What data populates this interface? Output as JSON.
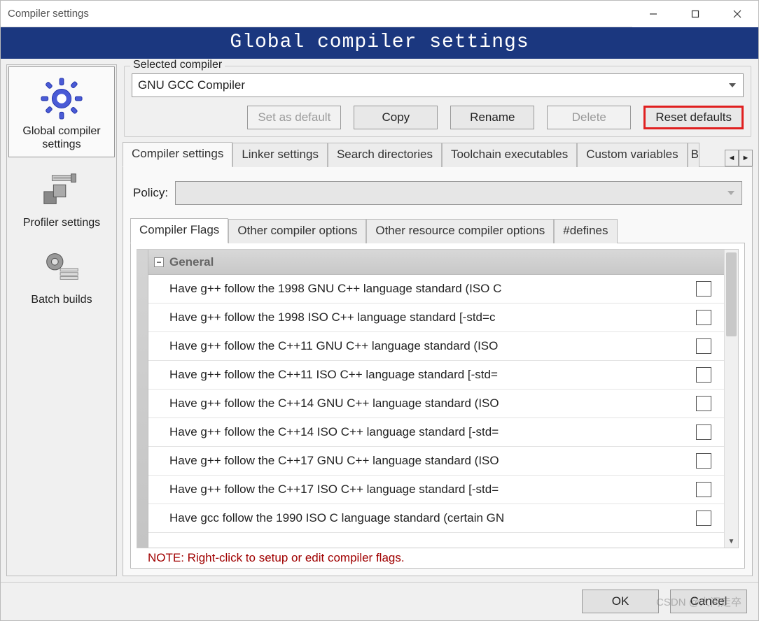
{
  "window": {
    "title": "Compiler settings"
  },
  "banner": "Global compiler settings",
  "sidebar": {
    "items": [
      {
        "label": "Global compiler settings",
        "icon": "gear-icon"
      },
      {
        "label": "Profiler settings",
        "icon": "profiler-icon"
      },
      {
        "label": "Batch builds",
        "icon": "batch-icon"
      }
    ]
  },
  "selected_compiler": {
    "group_label": "Selected compiler",
    "value": "GNU GCC Compiler",
    "buttons": {
      "set_default": "Set as default",
      "copy": "Copy",
      "rename": "Rename",
      "delete": "Delete",
      "reset": "Reset defaults"
    }
  },
  "outer_tabs": [
    "Compiler settings",
    "Linker settings",
    "Search directories",
    "Toolchain executables",
    "Custom variables",
    "B"
  ],
  "policy": {
    "label": "Policy:",
    "value": ""
  },
  "inner_tabs": [
    "Compiler Flags",
    "Other compiler options",
    "Other resource compiler options",
    "#defines"
  ],
  "flags": {
    "group": "General",
    "rows": [
      "Have g++ follow the 1998 GNU C++ language standard (ISO C",
      "Have g++ follow the 1998 ISO C++ language standard  [-std=c",
      "Have g++ follow the C++11 GNU C++ language standard (ISO",
      "Have g++ follow the C++11 ISO C++ language standard  [-std=",
      "Have g++ follow the C++14 GNU C++ language standard (ISO",
      "Have g++ follow the C++14 ISO C++ language standard  [-std=",
      "Have g++ follow the C++17 GNU C++ language standard (ISO",
      "Have g++ follow the C++17 ISO C++ language standard  [-std=",
      "Have gcc follow the 1990 ISO C language standard  (certain GN"
    ]
  },
  "note": "NOTE: Right-click to setup or edit compiler flags.",
  "footer": {
    "ok": "OK",
    "cancel": "Cancel"
  },
  "watermark": "CSDN @人间走卒"
}
